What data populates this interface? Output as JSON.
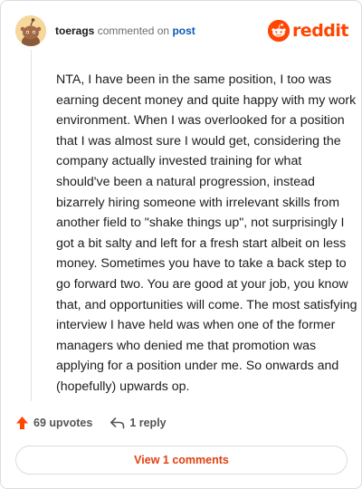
{
  "header": {
    "username": "toerags",
    "action_text": "commented on",
    "post_link": "post",
    "brand": "reddit"
  },
  "comment": {
    "body": "NTA, I have been in the same position, I too was earning decent money and quite happy with my work environment. When I was overlooked for a position that I was almost sure I would get, considering the company actually invested training for what should've been a natural progression, instead bizarrely hiring someone with irrelevant skills from another field to \"shake things up\", not surprisingly I got a bit salty and left for a fresh start albeit on less money. Sometimes you have to take a back step to go forward two. You are good at your job, you know that, and opportunities will come. The most satisfying interview I have held was when one of the former managers who denied me that promotion was applying for a position under me. So onwards and (hopefully) upwards op."
  },
  "actions": {
    "upvotes": "69 upvotes",
    "replies": "1 reply"
  },
  "footer": {
    "view_comments": "View 1 comments"
  },
  "colors": {
    "brand": "#ff4500",
    "link": "#0a5ab8",
    "view_button_text": "#e0410e"
  },
  "icons": {
    "avatar": "snoo-avatar",
    "brand": "reddit-logo-icon",
    "upvote": "upvote-arrow-icon",
    "reply": "reply-arrow-icon"
  }
}
